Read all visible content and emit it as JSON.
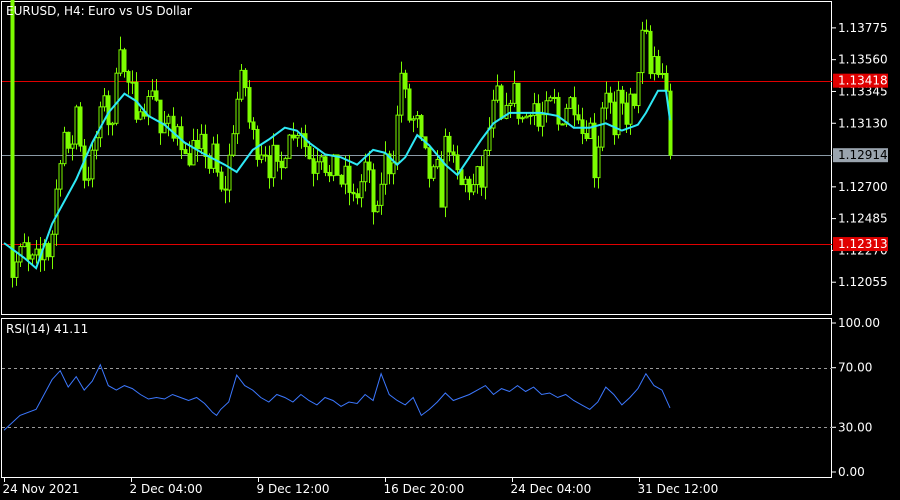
{
  "header": {
    "symbol_label": "EURUSD, H4:",
    "description": "Euro vs US Dollar"
  },
  "colors": {
    "background": "#000000",
    "candle": "#7cfc00",
    "ma_line": "#2ee8f5",
    "level_line": "#e00000",
    "current_line": "#8a9aa6",
    "current_label_bg": "#9aa4ae",
    "level_label_bg": "#e00000",
    "rsi_line": "#3c78ff",
    "grid_dash": "#9a9a9a"
  },
  "chart_data": [
    {
      "type": "candlestick",
      "title": "EURUSD, H4:  Euro vs US Dollar",
      "ylim": [
        1.1184,
        1.1395
      ],
      "y_ticks": [
        "1.13775",
        "1.13560",
        "1.13345",
        "1.13130",
        "1.12700",
        "1.12485",
        "1.12270",
        "1.12055"
      ],
      "x_ticks": [
        "24 Nov 2021",
        "2 Dec 04:00",
        "9 Dec 12:00",
        "16 Dec 20:00",
        "24 Dec 04:00",
        "31 Dec 12:00"
      ],
      "levels": [
        {
          "name": "resistance",
          "value": 1.13418,
          "label": "1.13418"
        },
        {
          "name": "support",
          "value": 1.12313,
          "label": "1.12313"
        }
      ],
      "current_price": {
        "value": 1.12914,
        "label": "1.12914"
      },
      "series": [
        {
          "name": "close",
          "anchors": [
            [
              0,
              1.2215
            ],
            [
              1,
              1.1205
            ],
            [
              2,
              1.1215
            ],
            [
              3,
              1.1225
            ],
            [
              4,
              1.123
            ],
            [
              5,
              1.1215
            ],
            [
              6,
              1.1225
            ],
            [
              7,
              1.1218
            ],
            [
              8,
              1.1235
            ],
            [
              9,
              1.122
            ],
            [
              10,
              1.126
            ],
            [
              11,
              1.129
            ],
            [
              12,
              1.131
            ],
            [
              13,
              1.128
            ],
            [
              14,
              1.133
            ],
            [
              15,
              1.13
            ],
            [
              16,
              1.127
            ],
            [
              17,
              1.1285
            ],
            [
              18,
              1.13
            ],
            [
              19,
              1.132
            ],
            [
              20,
              1.134
            ],
            [
              21,
              1.129
            ],
            [
              22,
              1.135
            ],
            [
              23,
              1.137
            ],
            [
              24,
              1.1335
            ],
            [
              25,
              1.1345
            ],
            [
              26,
              1.131
            ],
            [
              27,
              1.133
            ],
            [
              28,
              1.132
            ],
            [
              29,
              1.134
            ],
            [
              30,
              1.133
            ],
            [
              31,
              1.13
            ],
            [
              32,
              1.132
            ],
            [
              33,
              1.13
            ],
            [
              34,
              1.1315
            ],
            [
              35,
              1.1295
            ],
            [
              36,
              1.1285
            ],
            [
              37,
              1.13
            ],
            [
              38,
              1.129
            ],
            [
              39,
              1.1305
            ],
            [
              40,
              1.128
            ],
            [
              41,
              1.1295
            ],
            [
              42,
              1.1275
            ],
            [
              43,
              1.126
            ],
            [
              44,
              1.1285
            ],
            [
              45,
              1.131
            ],
            [
              46,
              1.1335
            ],
            [
              47,
              1.135
            ],
            [
              48,
              1.1315
            ],
            [
              49,
              1.1305
            ],
            [
              50,
              1.129
            ],
            [
              51,
              1.13
            ],
            [
              52,
              1.128
            ],
            [
              53,
              1.1295
            ],
            [
              54,
              1.1275
            ],
            [
              55,
              1.129
            ],
            [
              56,
              1.131
            ],
            [
              57,
              1.13
            ],
            [
              58,
              1.1315
            ],
            [
              59,
              1.13
            ],
            [
              60,
              1.129
            ],
            [
              61,
              1.128
            ],
            [
              62,
              1.13
            ],
            [
              63,
              1.1285
            ],
            [
              64,
              1.1275
            ],
            [
              65,
              1.129
            ],
            [
              66,
              1.127
            ],
            [
              67,
              1.128
            ],
            [
              68,
              1.1265
            ],
            [
              69,
              1.126
            ],
            [
              70,
              1.127
            ],
            [
              71,
              1.1285
            ],
            [
              72,
              1.1275
            ],
            [
              73,
              1.124
            ],
            [
              74,
              1.127
            ],
            [
              75,
              1.129
            ],
            [
              76,
              1.128
            ],
            [
              77,
              1.13
            ],
            [
              78,
              1.135
            ],
            [
              79,
              1.133
            ],
            [
              80,
              1.131
            ],
            [
              81,
              1.132
            ],
            [
              82,
              1.13
            ],
            [
              83,
              1.129
            ],
            [
              84,
              1.127
            ],
            [
              85,
              1.129
            ],
            [
              86,
              1.126
            ],
            [
              87,
              1.131
            ],
            [
              88,
              1.129
            ],
            [
              89,
              1.128
            ],
            [
              90,
              1.127
            ],
            [
              91,
              1.1275
            ],
            [
              92,
              1.1265
            ],
            [
              93,
              1.128
            ],
            [
              94,
              1.127
            ],
            [
              95,
              1.13
            ],
            [
              96,
              1.132
            ],
            [
              97,
              1.1335
            ],
            [
              98,
              1.131
            ],
            [
              99,
              1.1325
            ],
            [
              100,
              1.134
            ],
            [
              101,
              1.132
            ],
            [
              102,
              1.1315
            ],
            [
              103,
              1.132
            ],
            [
              104,
              1.133
            ],
            [
              105,
              1.131
            ],
            [
              106,
              1.132
            ],
            [
              107,
              1.1325
            ],
            [
              108,
              1.133
            ],
            [
              109,
              1.131
            ],
            [
              110,
              1.132
            ],
            [
              111,
              1.133
            ],
            [
              112,
              1.1325
            ],
            [
              113,
              1.132
            ],
            [
              114,
              1.13
            ],
            [
              115,
              1.132
            ],
            [
              116,
              1.128
            ],
            [
              117,
              1.1305
            ],
            [
              118,
              1.134
            ],
            [
              119,
              1.133
            ],
            [
              120,
              1.13
            ],
            [
              121,
              1.134
            ],
            [
              122,
              1.131
            ],
            [
              123,
              1.133
            ],
            [
              124,
              1.132
            ],
            [
              125,
              1.1365
            ],
            [
              126,
              1.138
            ],
            [
              127,
              1.1345
            ],
            [
              128,
              1.136
            ],
            [
              129,
              1.134
            ],
            [
              130,
              1.135
            ],
            [
              131,
              1.12914
            ]
          ]
        },
        {
          "name": "ma",
          "anchors": [
            [
              0,
              1.1232
            ],
            [
              5,
              1.1222
            ],
            [
              8,
              1.1215
            ],
            [
              12,
              1.1245
            ],
            [
              18,
              1.1275
            ],
            [
              22,
              1.13
            ],
            [
              26,
              1.132
            ],
            [
              30,
              1.1333
            ],
            [
              33,
              1.1328
            ],
            [
              36,
              1.1318
            ],
            [
              40,
              1.1312
            ],
            [
              45,
              1.13
            ],
            [
              50,
              1.1292
            ],
            [
              55,
              1.1285
            ],
            [
              58,
              1.128
            ],
            [
              62,
              1.1295
            ],
            [
              66,
              1.1302
            ],
            [
              70,
              1.131
            ],
            [
              73,
              1.1308
            ],
            [
              76,
              1.13
            ],
            [
              80,
              1.1292
            ],
            [
              84,
              1.129
            ],
            [
              88,
              1.1285
            ],
            [
              92,
              1.1295
            ],
            [
              95,
              1.1293
            ],
            [
              98,
              1.1285
            ],
            [
              100,
              1.129
            ],
            [
              103,
              1.1305
            ],
            [
              106,
              1.1298
            ],
            [
              110,
              1.1285
            ],
            [
              113,
              1.1278
            ],
            [
              116,
              1.129
            ],
            [
              119,
              1.1302
            ],
            [
              122,
              1.1313
            ],
            [
              126,
              1.132
            ],
            [
              130,
              1.132
            ],
            [
              134,
              1.132
            ],
            [
              138,
              1.1318
            ],
            [
              142,
              1.131
            ],
            [
              146,
              1.131
            ],
            [
              150,
              1.1313
            ],
            [
              154,
              1.1308
            ],
            [
              158,
              1.1312
            ],
            [
              160,
              1.132
            ],
            [
              163,
              1.1335
            ],
            [
              165,
              1.1335
            ],
            [
              166,
              1.1315
            ]
          ]
        }
      ]
    },
    {
      "type": "line",
      "title": "RSI(14) 41.11",
      "ylim": [
        0,
        100
      ],
      "y_ticks": [
        "100.00",
        "70.00",
        "30.00",
        "0.00"
      ],
      "levels": [
        70,
        30
      ],
      "series": [
        {
          "name": "RSI(14)",
          "anchors": [
            [
              0,
              28
            ],
            [
              4,
              38
            ],
            [
              8,
              42
            ],
            [
              12,
              62
            ],
            [
              14,
              68
            ],
            [
              16,
              57
            ],
            [
              18,
              64
            ],
            [
              20,
              55
            ],
            [
              22,
              61
            ],
            [
              24,
              72
            ],
            [
              26,
              58
            ],
            [
              28,
              55
            ],
            [
              30,
              58
            ],
            [
              32,
              56
            ],
            [
              34,
              52
            ],
            [
              36,
              49
            ],
            [
              38,
              50
            ],
            [
              40,
              49
            ],
            [
              42,
              52
            ],
            [
              44,
              50
            ],
            [
              46,
              48
            ],
            [
              48,
              50
            ],
            [
              50,
              46
            ],
            [
              52,
              40
            ],
            [
              53,
              38
            ],
            [
              54,
              42
            ],
            [
              56,
              47
            ],
            [
              58,
              65
            ],
            [
              60,
              58
            ],
            [
              62,
              55
            ],
            [
              64,
              50
            ],
            [
              66,
              47
            ],
            [
              68,
              52
            ],
            [
              70,
              50
            ],
            [
              72,
              47
            ],
            [
              74,
              52
            ],
            [
              76,
              48
            ],
            [
              78,
              45
            ],
            [
              80,
              50
            ],
            [
              82,
              48
            ],
            [
              84,
              44
            ],
            [
              86,
              47
            ],
            [
              88,
              46
            ],
            [
              90,
              52
            ],
            [
              92,
              48
            ],
            [
              94,
              66
            ],
            [
              96,
              52
            ],
            [
              98,
              48
            ],
            [
              100,
              45
            ],
            [
              102,
              50
            ],
            [
              104,
              38
            ],
            [
              106,
              42
            ],
            [
              108,
              47
            ],
            [
              110,
              53
            ],
            [
              112,
              48
            ],
            [
              114,
              50
            ],
            [
              116,
              52
            ],
            [
              118,
              55
            ],
            [
              120,
              58
            ],
            [
              122,
              52
            ],
            [
              124,
              56
            ],
            [
              126,
              54
            ],
            [
              128,
              58
            ],
            [
              130,
              54
            ],
            [
              132,
              57
            ],
            [
              134,
              52
            ],
            [
              136,
              53
            ],
            [
              138,
              50
            ],
            [
              140,
              52
            ],
            [
              142,
              48
            ],
            [
              144,
              45
            ],
            [
              146,
              42
            ],
            [
              148,
              47
            ],
            [
              150,
              57
            ],
            [
              152,
              52
            ],
            [
              154,
              45
            ],
            [
              156,
              50
            ],
            [
              158,
              56
            ],
            [
              160,
              66
            ],
            [
              162,
              58
            ],
            [
              164,
              55
            ],
            [
              166,
              43
            ]
          ]
        }
      ]
    }
  ]
}
